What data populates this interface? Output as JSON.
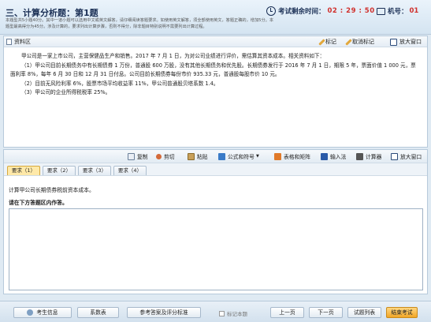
{
  "header": {
    "title": "三、计算分析题：第1题",
    "instructions": "本题型共5小题40分。其中一道小题可以选用中文或英文解答，请仔细阅读答题要求。如使用英文解答，须全部使用英文，答题正确的，增加5分。本题型最高得分为45分。涉及计算的，要求列出计算步骤，否则不得分，除非题目特别说明不需要列出计算过程。",
    "timer_label": "考试剩余时间：",
    "timer_value": "02 : 29 : 50",
    "seat_label": "机号：",
    "seat_value": "01"
  },
  "material": {
    "label": "资料区",
    "mark_label": "标记",
    "unmark_label": "取消标记",
    "enlarge_label": "放大窗口",
    "paragraphs": [
      "甲公司是一家上市公司，主营保健品生产和销售。2017 年 7 月 1 日，为对公司业绩进行评价，需估算其资本成本。相关资料如下：",
      "（1）甲公司目前长期债务中有长期债券 1 万份，普通股 600 万股，没有其他长期债务和优先股。长期债券发行于 2016 年 7 月 1 日，期限 5 年，票面价值 1 000 元，票面利率 8%，每年 6 月 30 日和 12 月 31 日付息。公司目前长期债券每份市价 935.33 元，普通股每股市价 10 元。",
      "（2）目前无风险利率 6%，股票市场平均收益率 11%，甲公司普通股贝塔系数 1.4。",
      "（3）甲公司的企业所得税税率 25%。"
    ]
  },
  "toolbar": {
    "copy": "复制",
    "cut": "剪切",
    "paste": "粘贴",
    "formula": "公式和符号",
    "table": "表格和矩阵",
    "ime": "输入法",
    "calculator": "计算器",
    "enlarge": "放大窗口"
  },
  "tabs": [
    "要求（1）",
    "要求（2）",
    "要求（3）",
    "要求（4）"
  ],
  "answer": {
    "requirement": "计算甲公司长期债券税前资本成本。",
    "hint": "请在下方答题区内作答。",
    "value": ""
  },
  "footer": {
    "candidate_info": "考生信息",
    "coefficient_table": "系数表",
    "reference": "参考答案及评分标准",
    "mark_question": "标记本题",
    "prev": "上一页",
    "next": "下一页",
    "question_list": "试题列表",
    "finish": "结束考试"
  },
  "colors": {
    "accent": "#1a2f55",
    "timer": "#d0302c",
    "active_tab": "#ffe9a8",
    "finish_button": "#f2a626"
  }
}
